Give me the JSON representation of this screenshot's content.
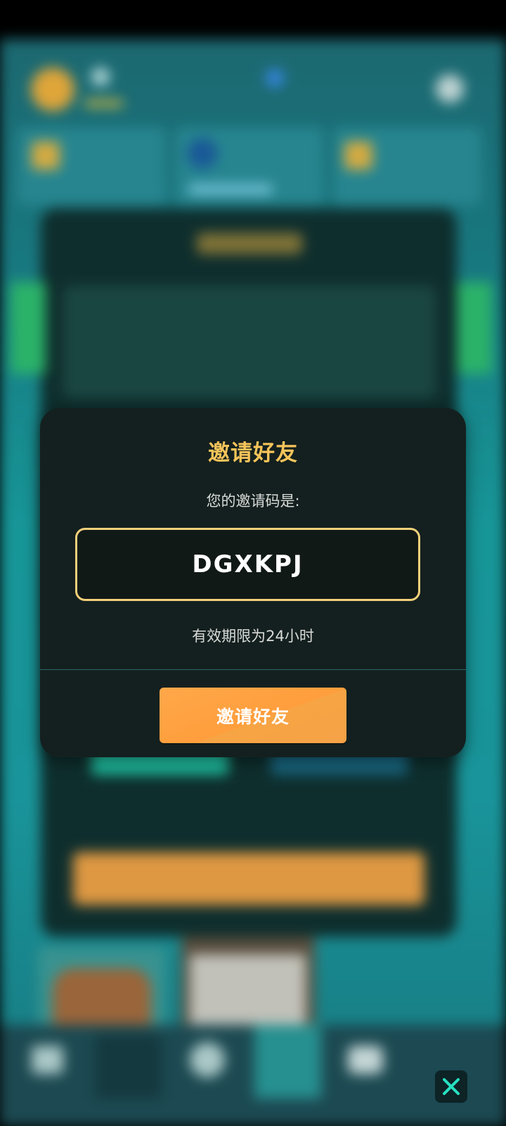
{
  "modal": {
    "title": "邀请好友",
    "code_label": "您的邀请码是:",
    "code_value": "DGXKPJ",
    "validity_text": "有效期限为24小时",
    "invite_button_label": "邀请好友"
  },
  "colors": {
    "title_gold": "#f6c45a",
    "code_border": "#f3d07a",
    "button_orange": "#ffa84a",
    "modal_bg": "#14201f",
    "close_icon_green": "#27e0c2"
  },
  "icons": {
    "close": "close-icon"
  }
}
